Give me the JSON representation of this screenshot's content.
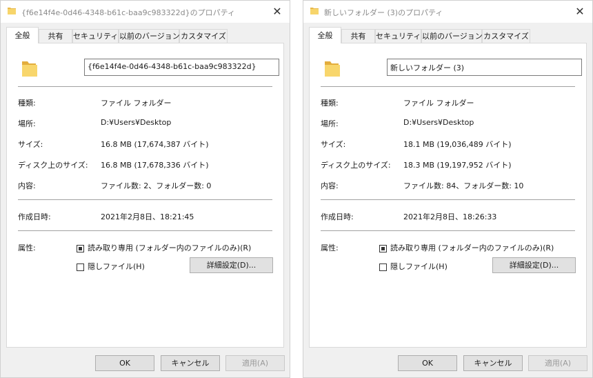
{
  "dialogs": [
    {
      "title": "{f6e14f4e-0d46-4348-b61c-baa9c983322d}のプロパティ",
      "tabs": [
        "全般",
        "共有",
        "セキュリティ",
        "以前のバージョン",
        "カスタマイズ"
      ],
      "name": "{f6e14f4e-0d46-4348-b61c-baa9c983322d}",
      "props": [
        {
          "label": "種類:",
          "value": "ファイル フォルダー"
        },
        {
          "label": "場所:",
          "value": "D:¥Users¥Desktop"
        },
        {
          "label": "サイズ:",
          "value": "16.8 MB (17,674,387 バイト)"
        },
        {
          "label": "ディスク上のサイズ:",
          "value": "16.8 MB (17,678,336 バイト)"
        },
        {
          "label": "内容:",
          "value": "ファイル数: 2、フォルダー数: 0"
        }
      ],
      "created_label": "作成日時:",
      "created_value": "2021年2月8日、18:21:45",
      "attributes_label": "属性:",
      "readonly_label": "読み取り専用 (フォルダー内のファイルのみ)(R)",
      "hidden_label": "隠しファイル(H)",
      "advanced_label": "詳細設定(D)...",
      "ok": "OK",
      "cancel": "キャンセル",
      "apply": "適用(A)"
    },
    {
      "title": "新しいフォルダー (3)のプロパティ",
      "tabs": [
        "全般",
        "共有",
        "セキュリティ",
        "以前のバージョン",
        "カスタマイズ"
      ],
      "name": "新しいフォルダー (3)",
      "props": [
        {
          "label": "種類:",
          "value": "ファイル フォルダー"
        },
        {
          "label": "場所:",
          "value": "D:¥Users¥Desktop"
        },
        {
          "label": "サイズ:",
          "value": "18.1 MB (19,036,489 バイト)"
        },
        {
          "label": "ディスク上のサイズ:",
          "value": "18.3 MB (19,197,952 バイト)"
        },
        {
          "label": "内容:",
          "value": "ファイル数: 84、フォルダー数: 10"
        }
      ],
      "created_label": "作成日時:",
      "created_value": "2021年2月8日、18:26:33",
      "attributes_label": "属性:",
      "readonly_label": "読み取り専用 (フォルダー内のファイルのみ)(R)",
      "hidden_label": "隠しファイル(H)",
      "advanced_label": "詳細設定(D)...",
      "ok": "OK",
      "cancel": "キャンセル",
      "apply": "適用(A)"
    }
  ]
}
